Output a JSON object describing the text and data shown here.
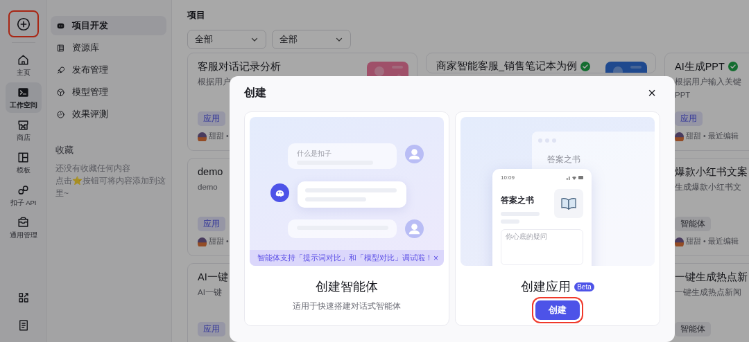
{
  "rail": {
    "create_button": {
      "annotated": true
    },
    "items": [
      {
        "label": "主页",
        "selected": false
      },
      {
        "label": "工作空间",
        "selected": true
      },
      {
        "label": "商店",
        "selected": false
      },
      {
        "label": "模板",
        "selected": false
      },
      {
        "label": "扣子 API",
        "selected": false
      },
      {
        "label": "通用管理",
        "selected": false
      }
    ],
    "bottom_icons": [
      {
        "kind": "apps"
      },
      {
        "kind": "document"
      }
    ]
  },
  "sidebar": {
    "items": [
      {
        "label": "项目开发",
        "selected": true
      },
      {
        "label": "资源库",
        "selected": false
      },
      {
        "label": "发布管理",
        "selected": false
      },
      {
        "label": "模型管理",
        "selected": false
      },
      {
        "label": "效果评测",
        "selected": false
      }
    ],
    "favorites": {
      "title": "收藏",
      "empty_hint": [
        "还没有收藏任何内容",
        "点击⭐按钮可将内容添加到这里~"
      ]
    }
  },
  "main": {
    "title": "项目",
    "filters": [
      {
        "value": "全部"
      },
      {
        "value": "全部"
      }
    ],
    "columns": [
      [
        {
          "title": "客服对话记录分析",
          "verified": false,
          "description": [
            "根据用户"
          ],
          "tag": {
            "label": "应用",
            "kind": "app"
          },
          "author": "甜甜 •",
          "thumbnail": {
            "kind": "picture"
          }
        },
        {
          "title": "demo",
          "verified": false,
          "description": [
            "demo"
          ],
          "tag": {
            "label": "应用",
            "kind": "app"
          },
          "author": "甜甜 •"
        },
        {
          "title": "AI一键",
          "verified": false,
          "description": [
            "AI一键"
          ],
          "tag": {
            "label": "应用",
            "kind": "app"
          }
        }
      ],
      [
        {
          "title": "商家智能客服_销售笔记本为例",
          "verified": true,
          "thumbnail": {
            "kind": "picture"
          }
        }
      ],
      [
        {
          "title": "AI生成PPT",
          "verified": true,
          "description": [
            "根据用户输入关键",
            "PPT"
          ],
          "tag": {
            "label": "应用",
            "kind": "app"
          },
          "author": "甜甜 • 最近编辑"
        },
        {
          "title": "爆款小红书文案",
          "verified": false,
          "description": [
            "生成爆款小红书文"
          ],
          "tag": {
            "label": "智能体",
            "kind": "agent"
          },
          "author": "甜甜 • 最近编辑"
        },
        {
          "title": "一键生成热点新",
          "verified": false,
          "description": [
            "一键生成热点新闻"
          ],
          "tag": {
            "label": "智能体",
            "kind": "agent"
          }
        }
      ]
    ]
  },
  "modal": {
    "title": "创建",
    "close": "×",
    "options": [
      {
        "kind": "agent",
        "title": "创建智能体",
        "subtitle": "适用于快速搭建对话式智能体",
        "illustration": {
          "question": "什么是扣子"
        },
        "notice": {
          "text": "智能体支持「提示词对比」和「模型对比」调试啦！",
          "close": "×"
        }
      },
      {
        "kind": "app",
        "title": "创建应用",
        "badge": "Beta",
        "button": {
          "label": "创建",
          "annotated": true
        },
        "illustration": {
          "window_title": "答案之书",
          "time": "10:09",
          "app_title": "答案之书",
          "input_placeholder": "你心底的疑问"
        }
      }
    ]
  }
}
